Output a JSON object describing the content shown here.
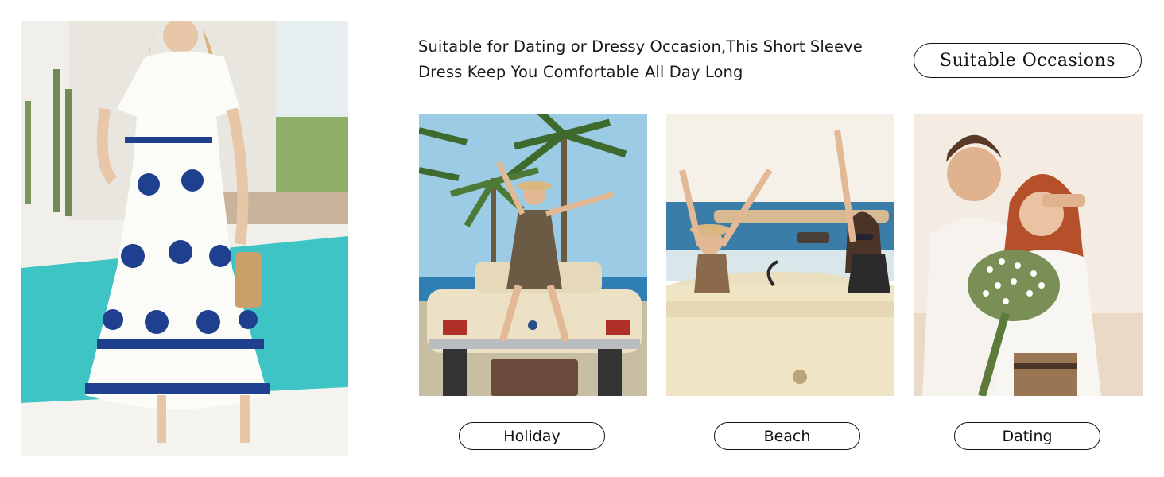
{
  "description": {
    "line1": "Suitable for Dating or Dressy Occasion,This Short Sleeve",
    "line2": "Dress Keep You Comfortable All Day Long"
  },
  "heading": "Suitable Occasions",
  "occasions": [
    {
      "label": "Holiday"
    },
    {
      "label": "Beach"
    },
    {
      "label": "Dating"
    }
  ],
  "colors": {
    "dress_print": "#1f3f8f",
    "pool": "#3fc4c6",
    "sky": "#9ccbe6",
    "car": "#ece1c4"
  }
}
